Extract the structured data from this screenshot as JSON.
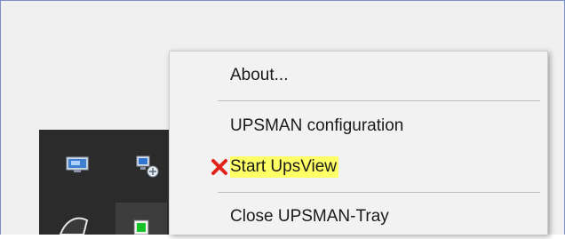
{
  "menu": {
    "items": [
      {
        "label": "About..."
      },
      {
        "label": "UPSMAN configuration"
      },
      {
        "label": "Start UpsView",
        "marker": "red-x-icon",
        "highlight": "#ffff66"
      },
      {
        "label": "Close UPSMAN-Tray"
      }
    ]
  },
  "tray": {
    "icons": [
      "monitor-icon",
      "network-computer-icon",
      "ups-tray-icon",
      "green-status-icon"
    ]
  },
  "colors": {
    "highlight": "#ffff66",
    "x_marker": "#e0241b",
    "tray_bg": "#2b2b2b",
    "menu_bg": "#f2f2f2"
  }
}
